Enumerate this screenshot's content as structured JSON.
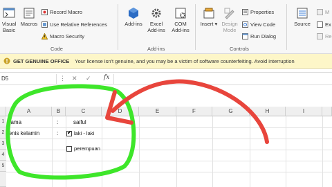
{
  "ribbon": {
    "visual_basic": "Visual Basic",
    "macros": "Macros",
    "record_macro": "Record Macro",
    "use_relative_refs": "Use Relative References",
    "macro_security": "Macro Security",
    "group_code": "Code",
    "add_ins": "Add-ins",
    "excel_add_ins": "Excel Add-ins",
    "com_add_ins": "COM Add-ins",
    "group_add_ins": "Add-ins",
    "insert": "Insert",
    "design_mode": "Design Mode",
    "properties": "Properties",
    "view_code": "View Code",
    "run_dialog": "Run Dialog",
    "group_controls": "Controls",
    "source": "Source",
    "xml_m": "M",
    "xml_ex": "Ex",
    "xml_re": "Re"
  },
  "message_bar": {
    "title": "GET GENUINE OFFICE",
    "text": "Your license isn't genuine, and you may be a victim of software counterfeiting. Avoid interruption"
  },
  "formula_bar": {
    "name_box": "D5",
    "cancel_symbol": "✕",
    "enter_symbol": "✓",
    "fx": "fx",
    "value": ""
  },
  "grid": {
    "columns": [
      "A",
      "B",
      "C",
      "D",
      "E",
      "F",
      "G",
      "H",
      "I"
    ],
    "rows": [
      "1",
      "2",
      "3",
      "4",
      "5"
    ],
    "cells": {
      "a1": "nama",
      "b1": ":",
      "c1": "saiful",
      "a2": "jenis kelamin",
      "b2": ":"
    },
    "checkboxes": [
      {
        "label": "laki - laki",
        "checked": true
      },
      {
        "label": "perempuan",
        "checked": false
      }
    ]
  },
  "annotations": {
    "ellipse_color": "#3ee62a",
    "arrow_color": "#e8453c"
  }
}
